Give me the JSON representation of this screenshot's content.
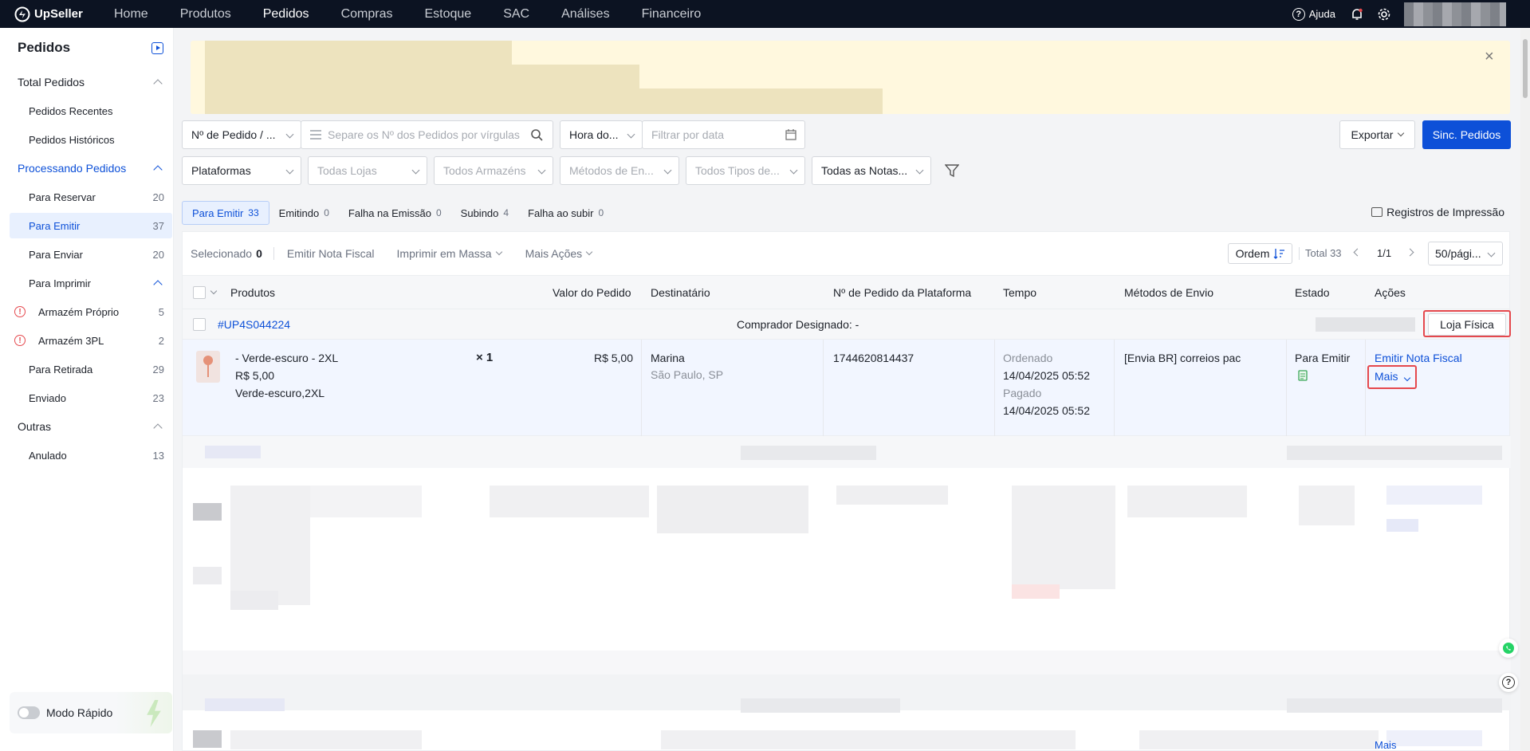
{
  "nav": {
    "brand": "UpSeller",
    "items": [
      "Home",
      "Produtos",
      "Pedidos",
      "Compras",
      "Estoque",
      "SAC",
      "Análises",
      "Financeiro"
    ],
    "active_index": 2,
    "help": "Ajuda"
  },
  "sidebar": {
    "title": "Pedidos",
    "total_group": "Total Pedidos",
    "recent": "Pedidos Recentes",
    "history": "Pedidos Históricos",
    "processing_group": "Processando Pedidos",
    "items": [
      {
        "label": "Para Reservar",
        "count": "20"
      },
      {
        "label": "Para Emitir",
        "count": "37"
      },
      {
        "label": "Para Enviar",
        "count": "20"
      },
      {
        "label": "Para Imprimir",
        "count": ""
      },
      {
        "label": "Armazém Próprio",
        "count": "5"
      },
      {
        "label": "Armazém 3PL",
        "count": "2"
      },
      {
        "label": "Para Retirada",
        "count": "29"
      },
      {
        "label": "Enviado",
        "count": "23"
      }
    ],
    "other_group": "Outras",
    "annulled": {
      "label": "Anulado",
      "count": "13"
    },
    "quick_mode": "Modo Rápido"
  },
  "filters": {
    "order_type": "Nº de Pedido / ...",
    "order_search_placeholder": "Separe os Nº dos Pedidos por vírgulas",
    "time_type": "Hora do...",
    "date_placeholder": "Filtrar por data",
    "platforms": "Plataformas",
    "stores": "Todas Lojas",
    "warehouses": "Todos Armazéns",
    "shipping_methods": "Métodos de En...",
    "types": "Todos Tipos de...",
    "notes": "Todas as Notas...",
    "export": "Exportar",
    "sync": "Sinc. Pedidos"
  },
  "tabs": [
    {
      "label": "Para Emitir",
      "count": "33"
    },
    {
      "label": "Emitindo",
      "count": "0"
    },
    {
      "label": "Falha na Emissão",
      "count": "0"
    },
    {
      "label": "Subindo",
      "count": "4"
    },
    {
      "label": "Falha ao subir",
      "count": "0"
    }
  ],
  "print_log": "Registros de Impressão",
  "toolbar": {
    "selected_label": "Selecionado",
    "selected_count": "0",
    "issue_invoice": "Emitir Nota Fiscal",
    "bulk_print": "Imprimir em Massa",
    "more_actions": "Mais Ações",
    "order": "Ordem",
    "total": "Total 33",
    "page": "1/1",
    "per_page": "50/pági..."
  },
  "columns": [
    "Produtos",
    "Valor do Pedido",
    "Destinatário",
    "Nº de Pedido da Plataforma",
    "Tempo",
    "Métodos de Envio",
    "Estado",
    "Ações"
  ],
  "order": {
    "id": "#UP4S044224",
    "buyer": "Comprador Designado: -",
    "store_type": "Loja Física",
    "product_name": "- Verde-escuro - 2XL",
    "product_price": "R$ 5,00",
    "product_variant": "Verde-escuro,2XL",
    "qty": "× 1",
    "value": "R$ 5,00",
    "recipient_name": "Marina",
    "recipient_city": "São Paulo, SP",
    "platform_no": "1744620814437",
    "ordered_label": "Ordenado",
    "ordered_time": "14/04/2025 05:52",
    "paid_label": "Pagado",
    "paid_time": "14/04/2025 05:52",
    "shipping": "[Envia BR] correios pac",
    "status": "Para Emitir",
    "action_issue": "Emitir Nota Fiscal",
    "action_more": "Mais"
  },
  "footer_more": "Mais"
}
